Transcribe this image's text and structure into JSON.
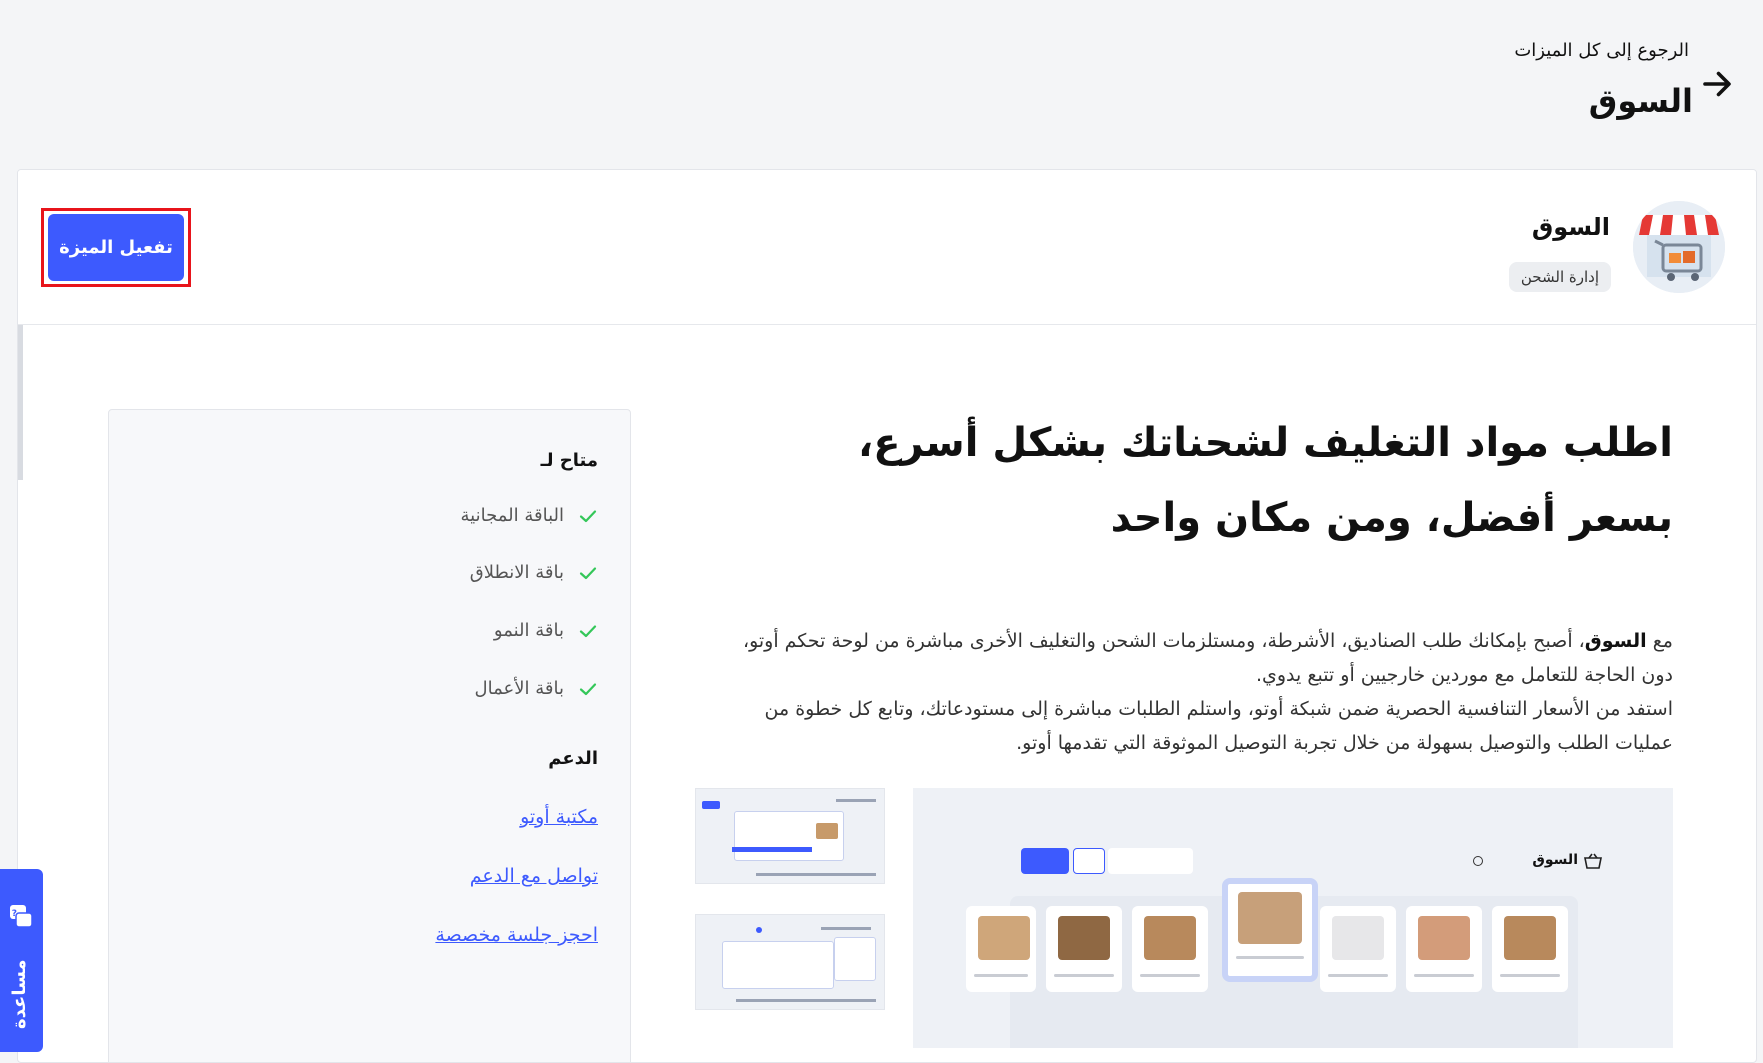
{
  "header": {
    "back_label": "الرجوع إلى كل الميزات",
    "page_title": "السوق"
  },
  "feature": {
    "name": "السوق",
    "category": "إدارة الشحن",
    "activate_label": "تفعيل الميزة"
  },
  "main": {
    "headline": "اطلب مواد التغليف لشحناتك بشكل أسرع، بسعر أفضل، ومن مكان واحد",
    "description": {
      "prefix": "مع ",
      "bold": "السوق",
      "line1_rest": "، أصبح بإمكانك طلب الصناديق، الأشرطة، ومستلزمات الشحن والتغليف الأخرى مباشرة من لوحة تحكم أوتو، دون الحاجة للتعامل مع موردين خارجيين أو تتبع يدوي.",
      "line2": "استفد من الأسعار التنافسية الحصرية ضمن شبكة أوتو، واستلم الطلبات مباشرة إلى مستودعاتك، وتابع كل خطوة من عمليات الطلب والتوصيل بسهولة من خلال تجربة التوصيل الموثوقة التي تقدمها أوتو."
    }
  },
  "sidebar": {
    "available_heading": "متاح لـ",
    "plans": [
      "الباقة المجانية",
      "باقة الانطلاق",
      "باقة النمو",
      "باقة الأعمال"
    ],
    "support_heading": "الدعم",
    "support_links": [
      "مكتبة أوتو",
      "تواصل مع الدعم",
      "احجز جلسة مخصصة"
    ]
  },
  "screenshot": {
    "title": "السوق"
  },
  "help": {
    "label": "مساعدة"
  },
  "colors": {
    "accent": "#3d5afe",
    "highlight": "#e8141b",
    "check": "#34c759"
  }
}
